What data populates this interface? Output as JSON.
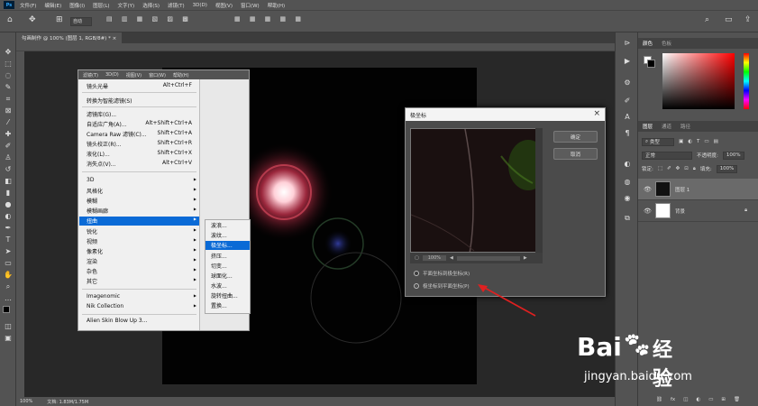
{
  "menubar": {
    "logo": "Ps",
    "items": [
      "文件(F)",
      "编辑(E)",
      "图像(I)",
      "图层(L)",
      "文字(Y)",
      "选择(S)",
      "滤镜(T)",
      "3D(D)",
      "视图(V)",
      "窗口(W)",
      "帮助(H)"
    ]
  },
  "options": {
    "mode_value": "自动"
  },
  "document_tab": {
    "label": "勾画制作 @ 100% (图层 1, RGB/8#) *"
  },
  "status": {
    "zoom": "100%",
    "doc": "文档: 1.83M/1.75M"
  },
  "filter_menu": {
    "bar": [
      "滤镜(T)",
      "3D(D)",
      "视图(V)",
      "窗口(W)",
      "帮助(H)"
    ],
    "top_items": [
      {
        "label": "镜头光晕",
        "shortcut": "Alt+Ctrl+F"
      },
      {
        "label": "转换为智能滤镜(S)",
        "shortcut": ""
      },
      {
        "label": "滤镜库(G)...",
        "shortcut": ""
      },
      {
        "label": "自适应广角(A)...",
        "shortcut": "Alt+Shift+Ctrl+A"
      },
      {
        "label": "Camera Raw 滤镜(C)...",
        "shortcut": "Shift+Ctrl+A"
      },
      {
        "label": "镜头校正(R)...",
        "shortcut": "Shift+Ctrl+R"
      },
      {
        "label": "液化(L)...",
        "shortcut": "Shift+Ctrl+X"
      },
      {
        "label": "消失点(V)...",
        "shortcut": "Alt+Ctrl+V"
      }
    ],
    "sub_items": [
      "3D",
      "风格化",
      "模糊",
      "模糊画廊",
      "扭曲",
      "锐化",
      "视频",
      "像素化",
      "渲染",
      "杂色",
      "其它"
    ],
    "active_sub": "扭曲",
    "plugins": [
      "Imagenomic",
      "Nik Collection",
      "Alien Skin Blow Up 3..."
    ],
    "submenu": [
      "波浪...",
      "波纹...",
      "极坐标...",
      "挤压...",
      "切变...",
      "球面化...",
      "水波...",
      "旋转扭曲...",
      "置换..."
    ],
    "submenu_active": "极坐标..."
  },
  "dialog": {
    "title": "极坐标",
    "ok": "确定",
    "cancel": "取消",
    "zoom": "100%",
    "opt1": "平面坐标到极坐标(R)",
    "opt2": "极坐标到平面坐标(P)"
  },
  "panels": {
    "color_tabs": [
      "颜色",
      "色板"
    ],
    "layer_tabs": [
      "图层",
      "通道",
      "路径"
    ],
    "kind_label": "类型",
    "blend_mode": "正常",
    "opacity_label": "不透明度:",
    "opacity_value": "100%",
    "lock_label": "锁定:",
    "fill_label": "填充:",
    "fill_value": "100%",
    "layers": [
      {
        "name": "图层 1"
      },
      {
        "name": "背景"
      }
    ]
  },
  "watermark": {
    "brand": "Bai",
    "brand2": "经验",
    "url": "jingyan.baidu.com"
  }
}
